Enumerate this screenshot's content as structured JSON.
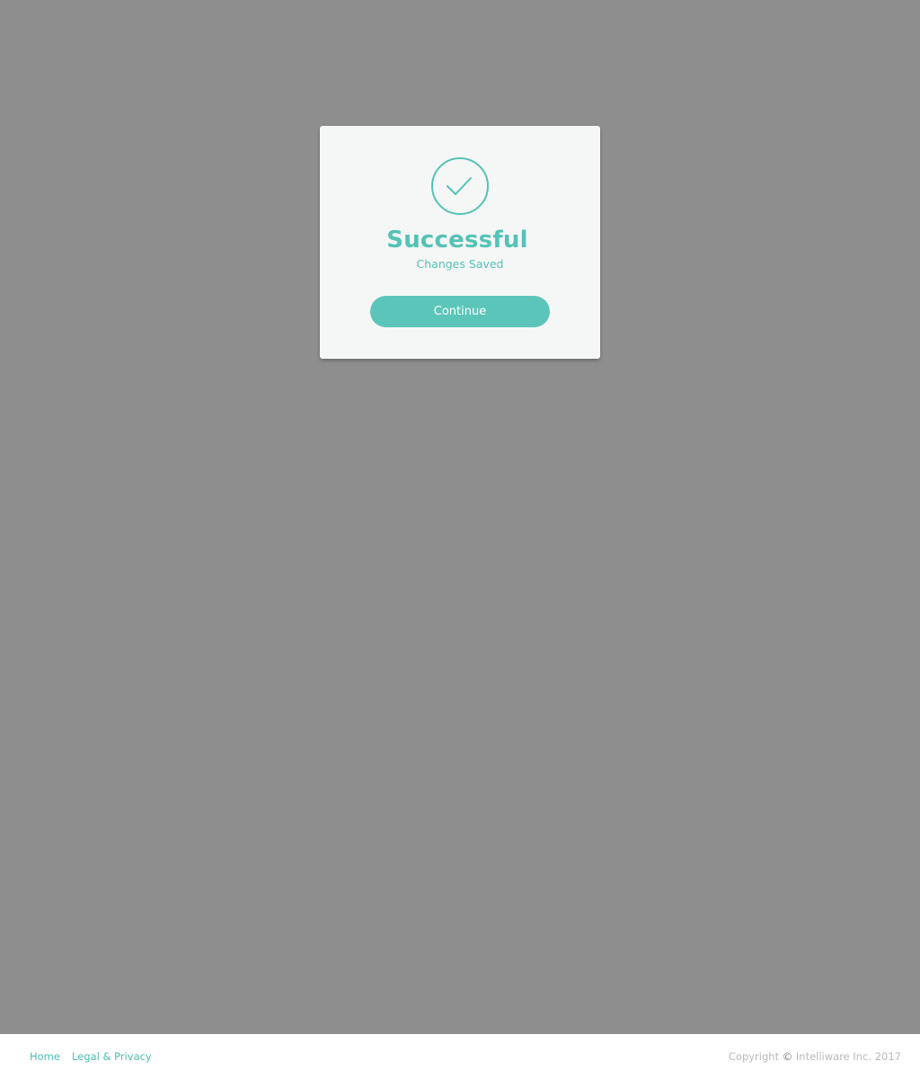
{
  "dialog": {
    "icon": "check-circle-icon",
    "title": "Successful",
    "subtitle": "Changes Saved",
    "continue_label": "Continue"
  },
  "footer": {
    "links": [
      {
        "label": "Home"
      },
      {
        "label": "Legal & Privacy"
      }
    ],
    "copyright_prefix": "Copyright",
    "copyright_symbol": "©",
    "copyright_owner": "Intelliware Inc. 2017"
  },
  "colors": {
    "accent": "#55c2b6",
    "overlay": "#8e8e8e",
    "modal_bg": "#f5f7f6"
  }
}
